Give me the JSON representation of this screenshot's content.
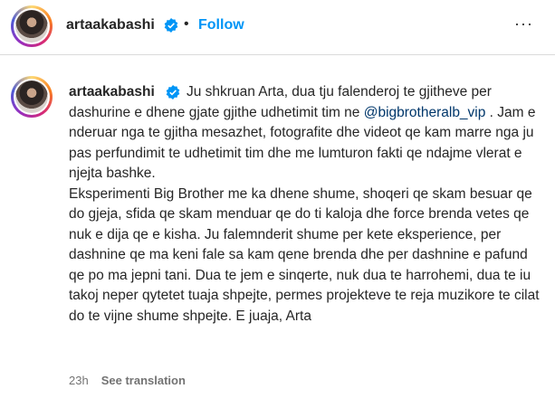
{
  "header": {
    "username": "artaakabashi",
    "follow_label": "Follow",
    "separator": "•",
    "more_label": "···",
    "verified_icon": "verified-badge-icon"
  },
  "post": {
    "username": "artaakabashi",
    "caption_1": "Ju shkruan Arta, dua tju falenderoj te gjitheve per dashurine e dhene gjate gjithe udhetimit tim ne ",
    "mention": "@bigbrotheralb_vip",
    "caption_2": " . Jam e nderuar nga te gjitha mesazhet, fotografite dhe videot qe kam marre nga ju pas perfundimit te udhetimit tim dhe me lumturon fakti qe ndajme vlerat e njejta bashke.",
    "caption_3": "Eksperimenti Big Brother me ka dhene shume, shoqeri qe skam besuar qe do gjeja, sfida qe skam menduar qe do ti kaloja dhe force brenda vetes qe nuk e dija qe e kisha. Ju falemnderit shume per kete eksperience, per dashnine qe ma keni fale sa kam qene brenda dhe per dashnine e pafund qe po ma jepni tani. Dua te jem e sinqerte, nuk dua te harrohemi, dua te iu takoj neper qytetet tuaja shpejte, permes projekteve te reja muzikore te cilat do te vijne shume shpejte. E juaja, Arta",
    "time": "23h",
    "translation_label": "See translation"
  },
  "colors": {
    "link_blue": "#0095f6",
    "mention": "#00376b",
    "verified": "#0095f6",
    "muted": "#737373"
  }
}
